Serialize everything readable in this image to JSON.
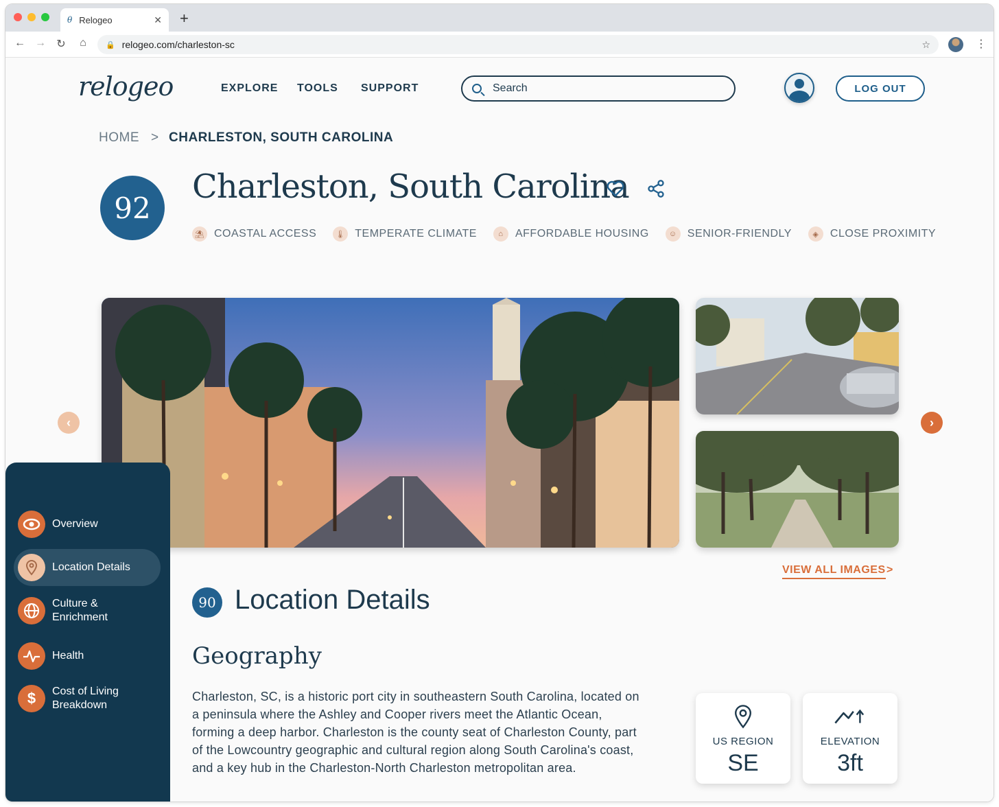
{
  "browser": {
    "tab_title": "Relogeo",
    "favicon": "θ",
    "url": "relogeo.com/charleston-sc"
  },
  "header": {
    "logo": "relogeo",
    "nav": [
      "EXPLORE",
      "TOOLS",
      "SUPPORT"
    ],
    "search_placeholder": "Search",
    "logout_label": "LOG OUT"
  },
  "breadcrumb": {
    "home": "HOME",
    "separator": ">",
    "current": "CHARLESTON, SOUTH CAROLINA"
  },
  "city": {
    "score": "92",
    "title": "Charleston, South Carolina",
    "tags": [
      {
        "label": "COASTAL ACCESS",
        "icon": "beach-icon"
      },
      {
        "label": "TEMPERATE CLIMATE",
        "icon": "thermometer-icon"
      },
      {
        "label": "AFFORDABLE HOUSING",
        "icon": "house-icon"
      },
      {
        "label": "SENIOR-FRIENDLY",
        "icon": "senior-icon"
      },
      {
        "label": "CLOSE PROXIMITY",
        "icon": "location-icon"
      }
    ]
  },
  "gallery": {
    "view_all_label": "VIEW ALL IMAGES",
    "view_all_chevron": ">"
  },
  "section": {
    "score": "90",
    "title": "Location Details",
    "subtitle": "Geography",
    "paragraph": "Charleston, SC, is a historic port city in southeastern South Carolina, located on a peninsula where the Ashley and Cooper rivers meet the Atlantic Ocean, forming a deep harbor. Charleston is the county seat of Charleston County, part of the Lowcountry geographic and cultural region along South Carolina's coast, and a key hub in the Charleston-North Charleston metropolitan area.",
    "stats": [
      {
        "label": "US REGION",
        "value": "SE",
        "icon": "map-pin-icon"
      },
      {
        "label": "ELEVATION",
        "value": "3ft",
        "icon": "mountain-icon"
      }
    ]
  },
  "sidebar": {
    "items": [
      {
        "label": "Overview",
        "icon": "eye-icon"
      },
      {
        "label": "Location Details",
        "icon": "map-pin-icon"
      },
      {
        "label": "Culture & Enrichment",
        "icon": "globe-icon"
      },
      {
        "label": "Health",
        "icon": "pulse-icon"
      },
      {
        "label": "Cost of Living Breakdown",
        "icon": "dollar-icon"
      }
    ]
  },
  "colors": {
    "navy": "#1e3a4d",
    "blue": "#22618f",
    "orange": "#d96e3a",
    "sidebar": "#12384f"
  }
}
